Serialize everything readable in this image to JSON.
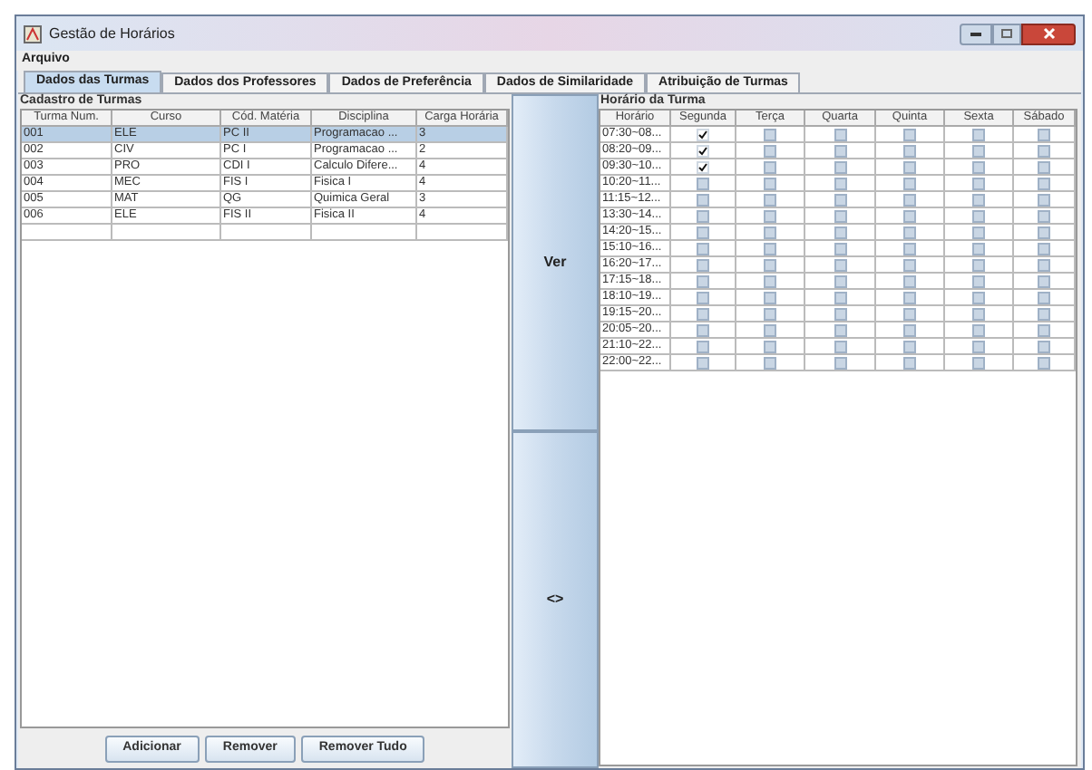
{
  "window": {
    "title": "Gestão de Horários"
  },
  "menu": [
    "Arquivo"
  ],
  "tabs": [
    {
      "label": "Dados das Turmas",
      "selected": true
    },
    {
      "label": "Dados dos Professores",
      "selected": false
    },
    {
      "label": "Dados de Preferência",
      "selected": false
    },
    {
      "label": "Dados de Similaridade",
      "selected": false
    },
    {
      "label": "Atribuição de Turmas",
      "selected": false
    }
  ],
  "cadastro": {
    "title": "Cadastro de Turmas",
    "columns": [
      "Turma Num.",
      "Curso",
      "Cód. Matéria",
      "Disciplina",
      "Carga Horária"
    ],
    "rows": [
      {
        "cells": [
          "001",
          "ELE",
          "PC II",
          "Programacao ...",
          "3"
        ],
        "selected": true
      },
      {
        "cells": [
          "002",
          "CIV",
          "PC I",
          "Programacao ...",
          "2"
        ],
        "selected": false
      },
      {
        "cells": [
          "003",
          "PRO",
          "CDI I",
          "Calculo Difere...",
          "4"
        ],
        "selected": false
      },
      {
        "cells": [
          "004",
          "MEC",
          "FIS I",
          "Fisica I",
          "4"
        ],
        "selected": false
      },
      {
        "cells": [
          "005",
          "MAT",
          "QG",
          "Quimica Geral",
          "3"
        ],
        "selected": false
      },
      {
        "cells": [
          "006",
          "ELE",
          "FIS II",
          "Fisica II",
          "4"
        ],
        "selected": false
      }
    ],
    "buttons": [
      "Adicionar",
      "Remover",
      "Remover Tudo"
    ]
  },
  "middle_buttons": [
    "Ver",
    "<>"
  ],
  "horario": {
    "title": "Horário da Turma",
    "columns": [
      "Horário",
      "Segunda",
      "Terça",
      "Quarta",
      "Quinta",
      "Sexta",
      "Sábado"
    ],
    "rows": [
      {
        "time": "07:30~08...",
        "checked": [
          true,
          false,
          false,
          false,
          false,
          false
        ]
      },
      {
        "time": "08:20~09...",
        "checked": [
          true,
          false,
          false,
          false,
          false,
          false
        ]
      },
      {
        "time": "09:30~10...",
        "checked": [
          true,
          false,
          false,
          false,
          false,
          false
        ]
      },
      {
        "time": "10:20~11...",
        "checked": [
          false,
          false,
          false,
          false,
          false,
          false
        ]
      },
      {
        "time": "11:15~12...",
        "checked": [
          false,
          false,
          false,
          false,
          false,
          false
        ]
      },
      {
        "time": "13:30~14...",
        "checked": [
          false,
          false,
          false,
          false,
          false,
          false
        ]
      },
      {
        "time": "14:20~15...",
        "checked": [
          false,
          false,
          false,
          false,
          false,
          false
        ]
      },
      {
        "time": "15:10~16...",
        "checked": [
          false,
          false,
          false,
          false,
          false,
          false
        ]
      },
      {
        "time": "16:20~17...",
        "checked": [
          false,
          false,
          false,
          false,
          false,
          false
        ]
      },
      {
        "time": "17:15~18...",
        "checked": [
          false,
          false,
          false,
          false,
          false,
          false
        ]
      },
      {
        "time": "18:10~19...",
        "checked": [
          false,
          false,
          false,
          false,
          false,
          false
        ]
      },
      {
        "time": "19:15~20...",
        "checked": [
          false,
          false,
          false,
          false,
          false,
          false
        ]
      },
      {
        "time": "20:05~20...",
        "checked": [
          false,
          false,
          false,
          false,
          false,
          false
        ]
      },
      {
        "time": "21:10~22...",
        "checked": [
          false,
          false,
          false,
          false,
          false,
          false
        ]
      },
      {
        "time": "22:00~22...",
        "checked": [
          false,
          false,
          false,
          false,
          false,
          false
        ]
      }
    ]
  }
}
